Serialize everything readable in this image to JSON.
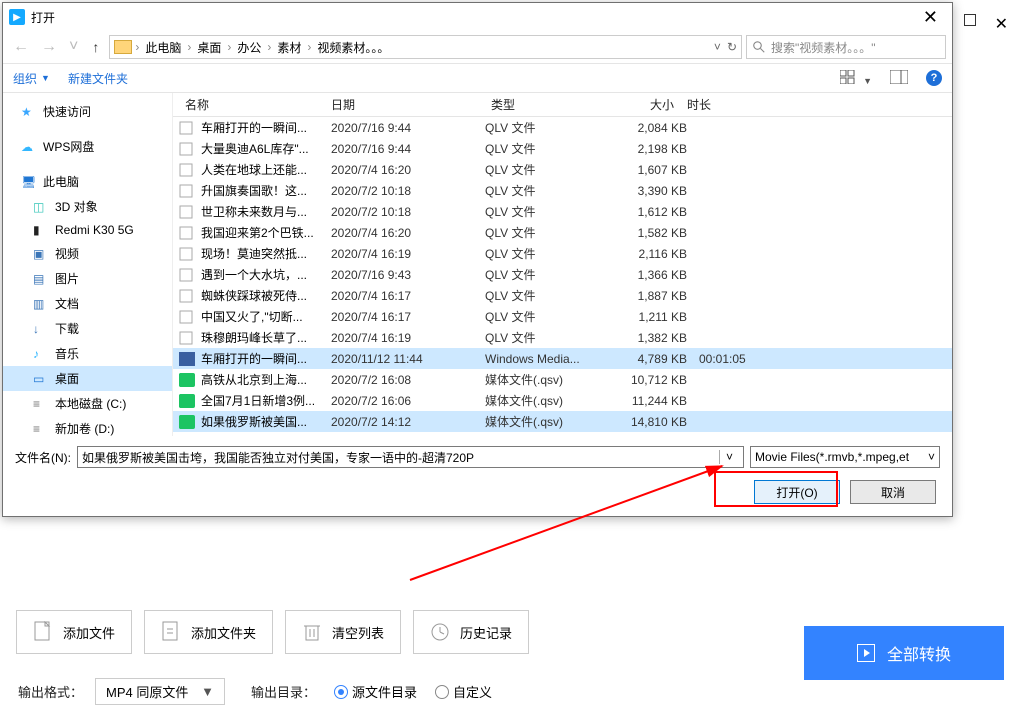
{
  "dialog": {
    "title": "打开",
    "breadcrumb": [
      "此电脑",
      "桌面",
      "办公",
      "素材",
      "视频素材。。。"
    ],
    "search_placeholder": "搜索\"视频素材。。。\"",
    "organize": "组织",
    "new_folder": "新建文件夹",
    "columns": {
      "name": "名称",
      "date": "日期",
      "type": "类型",
      "size": "大小",
      "duration": "时长"
    },
    "filename_label": "文件名(N):",
    "filename_value": "如果俄罗斯被美国击垮，我国能否独立对付美国，专家一语中的-超清720P",
    "filter": "Movie Files(*.rmvb,*.mpeg,et",
    "open_btn": "打开(O)",
    "cancel_btn": "取消"
  },
  "sidebar": [
    {
      "label": "快速访问",
      "icon": "star"
    },
    {
      "label": "WPS网盘",
      "icon": "cloud"
    },
    {
      "label": "此电脑",
      "icon": "pc"
    },
    {
      "label": "3D 对象",
      "icon": "cube",
      "nested": true
    },
    {
      "label": "Redmi K30 5G",
      "icon": "phone",
      "nested": true
    },
    {
      "label": "视频",
      "icon": "vid",
      "nested": true
    },
    {
      "label": "图片",
      "icon": "img",
      "nested": true
    },
    {
      "label": "文档",
      "icon": "doc",
      "nested": true
    },
    {
      "label": "下载",
      "icon": "dl",
      "nested": true
    },
    {
      "label": "音乐",
      "icon": "music",
      "nested": true
    },
    {
      "label": "桌面",
      "icon": "desk",
      "nested": true,
      "selected": true
    },
    {
      "label": "本地磁盘 (C:)",
      "icon": "disk",
      "nested": true
    },
    {
      "label": "新加卷 (D:)",
      "icon": "disk",
      "nested": true
    }
  ],
  "files": [
    {
      "name": "车厢打开的一瞬间...",
      "date": "2020/7/16 9:44",
      "type": "QLV 文件",
      "size": "2,084 KB",
      "icon": "qlv"
    },
    {
      "name": "大量奥迪A6L库存\"...",
      "date": "2020/7/16 9:44",
      "type": "QLV 文件",
      "size": "2,198 KB",
      "icon": "qlv"
    },
    {
      "name": "人类在地球上还能...",
      "date": "2020/7/4 16:20",
      "type": "QLV 文件",
      "size": "1,607 KB",
      "icon": "qlv"
    },
    {
      "name": "升国旗奏国歌！这...",
      "date": "2020/7/2 10:18",
      "type": "QLV 文件",
      "size": "3,390 KB",
      "icon": "qlv"
    },
    {
      "name": "世卫称未来数月与...",
      "date": "2020/7/2 10:18",
      "type": "QLV 文件",
      "size": "1,612 KB",
      "icon": "qlv"
    },
    {
      "name": "我国迎来第2个巴铁...",
      "date": "2020/7/4 16:20",
      "type": "QLV 文件",
      "size": "1,582 KB",
      "icon": "qlv"
    },
    {
      "name": "现场！莫迪突然抵...",
      "date": "2020/7/4 16:19",
      "type": "QLV 文件",
      "size": "2,116 KB",
      "icon": "qlv"
    },
    {
      "name": "遇到一个大水坑，...",
      "date": "2020/7/16 9:43",
      "type": "QLV 文件",
      "size": "1,366 KB",
      "icon": "qlv"
    },
    {
      "name": "蜘蛛侠踩球被死侍...",
      "date": "2020/7/4 16:17",
      "type": "QLV 文件",
      "size": "1,887 KB",
      "icon": "qlv"
    },
    {
      "name": "中国又火了,\"切断...",
      "date": "2020/7/4 16:17",
      "type": "QLV 文件",
      "size": "1,211 KB",
      "icon": "qlv"
    },
    {
      "name": "珠穆朗玛峰长草了...",
      "date": "2020/7/4 16:19",
      "type": "QLV 文件",
      "size": "1,382 KB",
      "icon": "qlv"
    },
    {
      "name": "车厢打开的一瞬间...",
      "date": "2020/11/12 11:44",
      "type": "Windows Media...",
      "size": "4,789 KB",
      "duration": "00:01:05",
      "icon": "wmv",
      "selected": true
    },
    {
      "name": "高铁从北京到上海...",
      "date": "2020/7/2 16:08",
      "type": "媒体文件(.qsv)",
      "size": "10,712 KB",
      "icon": "qsv"
    },
    {
      "name": "全国7月1日新增3例...",
      "date": "2020/7/2 16:06",
      "type": "媒体文件(.qsv)",
      "size": "11,244 KB",
      "icon": "qsv"
    },
    {
      "name": "如果俄罗斯被美国...",
      "date": "2020/7/2 14:12",
      "type": "媒体文件(.qsv)",
      "size": "14,810 KB",
      "icon": "qsv",
      "selected": true
    }
  ],
  "app": {
    "add_file": "添加文件",
    "add_folder": "添加文件夹",
    "clear_list": "清空列表",
    "history": "历史记录",
    "convert_all": "全部转换",
    "out_format_label": "输出格式：",
    "out_format_value": "MP4 同原文件",
    "out_dir_label": "输出目录：",
    "out_dir_source": "源文件目录",
    "out_dir_custom": "自定义"
  }
}
